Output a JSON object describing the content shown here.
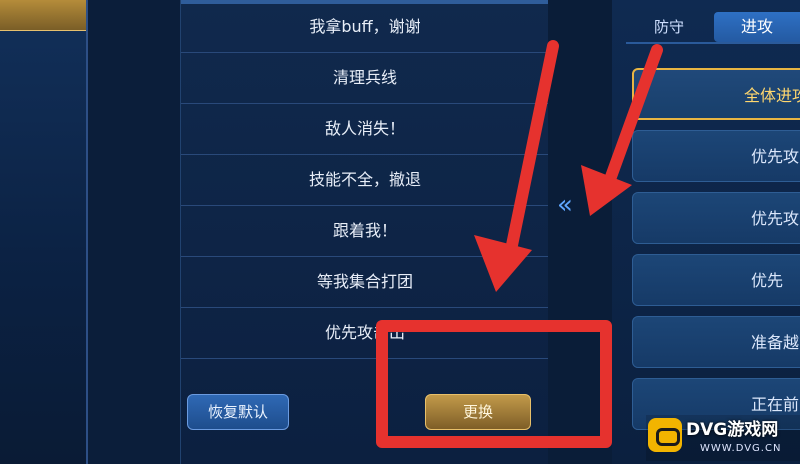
{
  "left_tab": {
    "label": ""
  },
  "chat": {
    "messages": [
      "我拿buff，谢谢",
      "清理兵线",
      "敌人消失！",
      "技能不全，撤退",
      "跟着我！",
      "等我集合打团",
      "优先攻击出"
    ]
  },
  "buttons": {
    "reset_label": "恢复默认",
    "replace_label": "更换"
  },
  "transfer": {
    "chevron": "«"
  },
  "tabs": {
    "defend": "防守",
    "attack": "进攻"
  },
  "options": [
    {
      "label": "全体进攻",
      "selected": true
    },
    {
      "label": "优先攻",
      "selected": false
    },
    {
      "label": "优先攻",
      "selected": false
    },
    {
      "label": "优先",
      "selected": false
    },
    {
      "label": "准备越",
      "selected": false
    },
    {
      "label": "正在前",
      "selected": false
    }
  ],
  "watermark": {
    "title": "DVG游戏网",
    "url": "WWW.DVG.CN"
  },
  "colors": {
    "annotation_red": "#e6322e",
    "gold": "#e8b543",
    "accent_blue": "#2e70c4",
    "background": "#0b1e3a"
  },
  "icons": {
    "transfer": "double-chevron-left-icon",
    "logo": "gamepad-icon"
  }
}
